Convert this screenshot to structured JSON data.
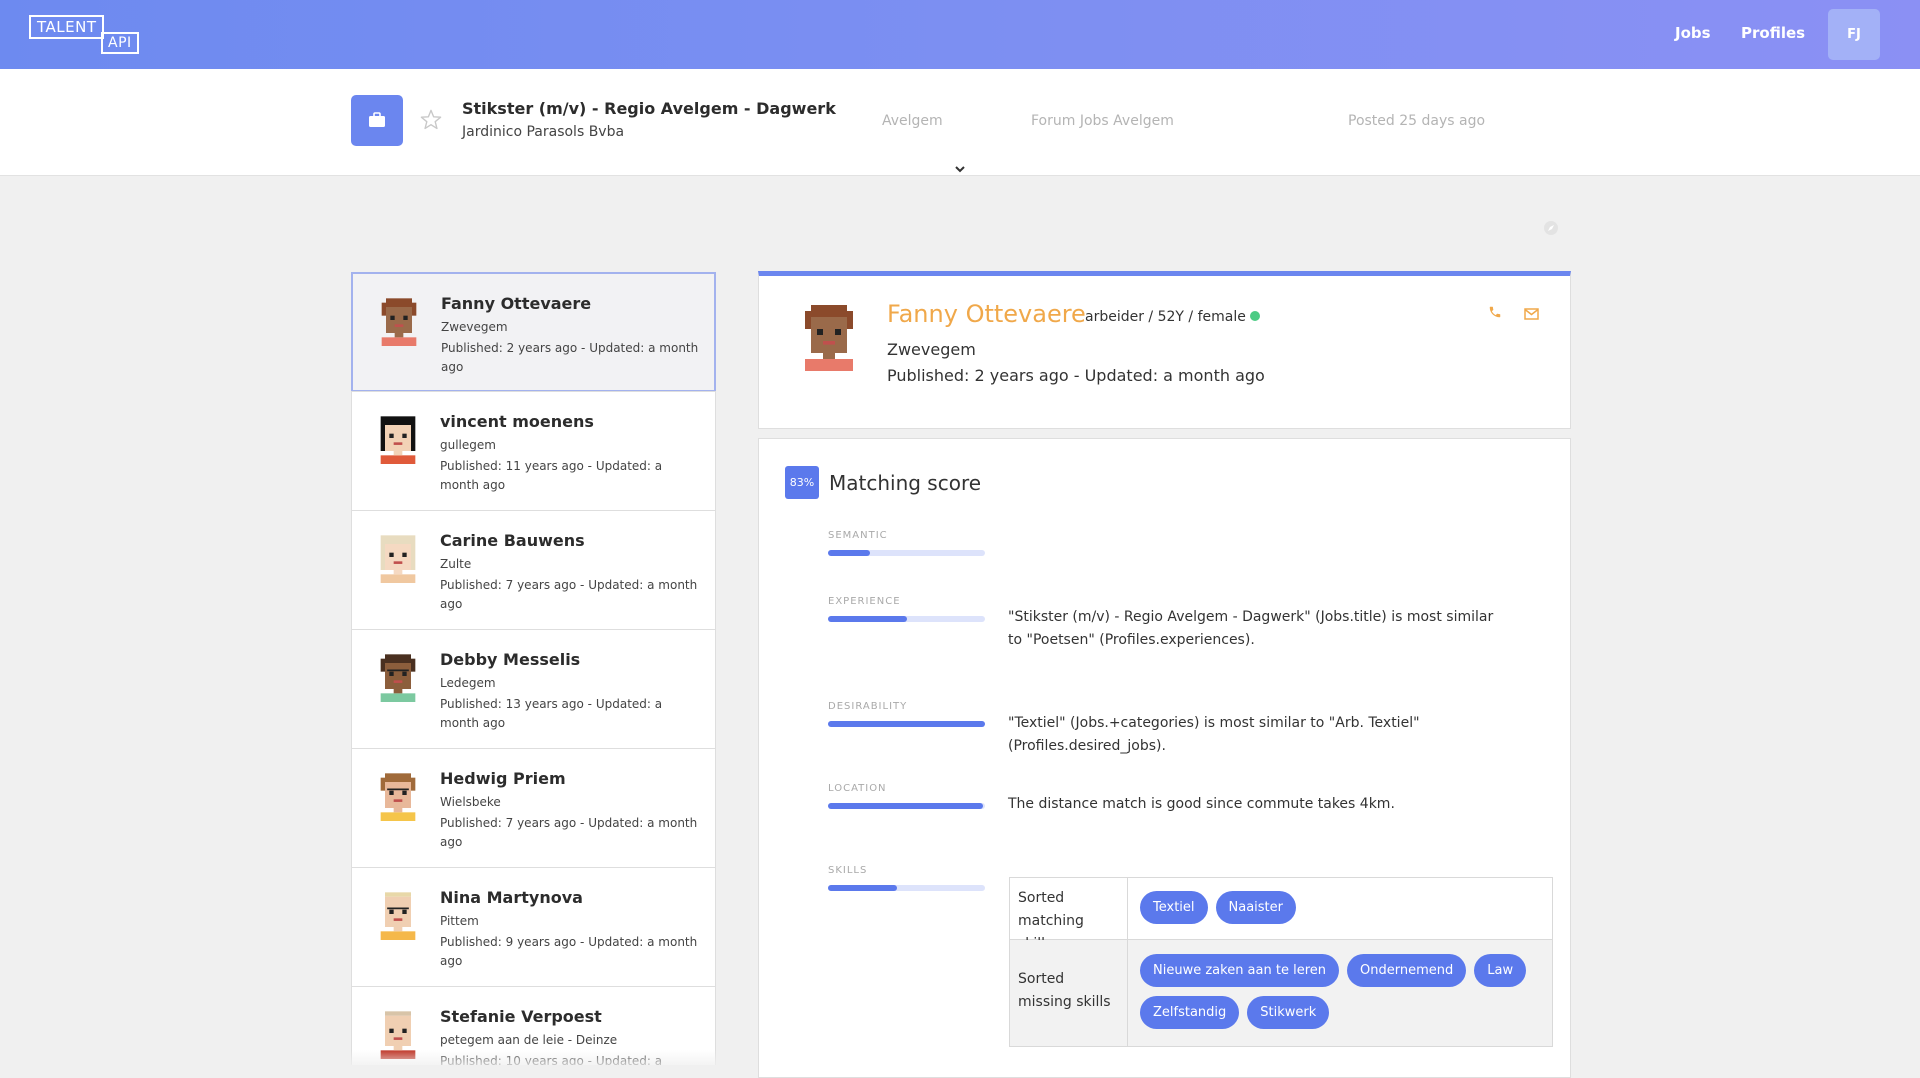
{
  "header": {
    "logo_top": "TALENT",
    "logo_bottom": "API",
    "nav": {
      "jobs": "Jobs",
      "profiles": "Profiles"
    },
    "user_initials": "FJ"
  },
  "job": {
    "title": "Stikster (m/v) - Regio Avelgem - Dagwerk",
    "company": "Jardinico Parasols Bvba",
    "location": "Avelgem",
    "source": "Forum Jobs Avelgem",
    "posted": "Posted 25 days ago"
  },
  "candidates": [
    {
      "name": "Fanny Ottevaere",
      "city": "Zwevegem",
      "published": "Published: 2 years ago - Updated: a month ago"
    },
    {
      "name": "vincent moenens",
      "city": "gullegem",
      "published": "Published: 11 years ago - Updated: a month ago"
    },
    {
      "name": "Carine Bauwens",
      "city": "Zulte",
      "published": "Published: 7 years ago - Updated: a month ago"
    },
    {
      "name": "Debby Messelis",
      "city": "Ledegem",
      "published": "Published: 13 years ago - Updated: a month ago"
    },
    {
      "name": "Hedwig Priem",
      "city": "Wielsbeke",
      "published": "Published: 7 years ago - Updated: a month ago"
    },
    {
      "name": "Nina Martynova",
      "city": "Pittem",
      "published": "Published: 9 years ago - Updated: a month ago"
    },
    {
      "name": "Stefanie Verpoest",
      "city": "petegem aan de leie - Deinze",
      "published": "Published: 10 years ago - Updated: a"
    }
  ],
  "profile": {
    "name": "Fanny Ottevaere",
    "meta": "arbeider / 52Y / female",
    "city": "Zwevegem",
    "published": "Published: 2 years ago - Updated: a month ago"
  },
  "matching": {
    "score": "83%",
    "title": "Matching score",
    "criteria": [
      {
        "label": "SEMANTIC",
        "fraction": 0.27,
        "explanation": ""
      },
      {
        "label": "EXPERIENCE",
        "fraction": 0.5,
        "explanation": "\"Stikster (m/v) - Regio Avelgem - Dagwerk\" (Jobs.title) is most similar to \"Poetsen\" (Profiles.experiences)."
      },
      {
        "label": "DESIRABILITY",
        "fraction": 1.0,
        "explanation": "\"Textiel\" (Jobs.+categories) is most similar to \"Arb. Textiel\" (Profiles.desired_jobs)."
      },
      {
        "label": "LOCATION",
        "fraction": 0.99,
        "explanation": "The distance match is good since commute takes 4km."
      },
      {
        "label": "SKILLS",
        "fraction": 0.44,
        "explanation": ""
      }
    ],
    "skills": {
      "matching_label": "Sorted matching skills",
      "matching": [
        "Textiel",
        "Naaister"
      ],
      "missing_label": "Sorted missing skills",
      "missing": [
        "Nieuwe zaken aan te leren",
        "Ondernemend",
        "Law",
        "Zelfstandig",
        "Stikwerk"
      ]
    }
  },
  "colors": {
    "accent": "#5b79ec",
    "header_gradient_start": "#6d8af0",
    "name_orange": "#f0a84a",
    "online_green": "#4ccb84"
  }
}
